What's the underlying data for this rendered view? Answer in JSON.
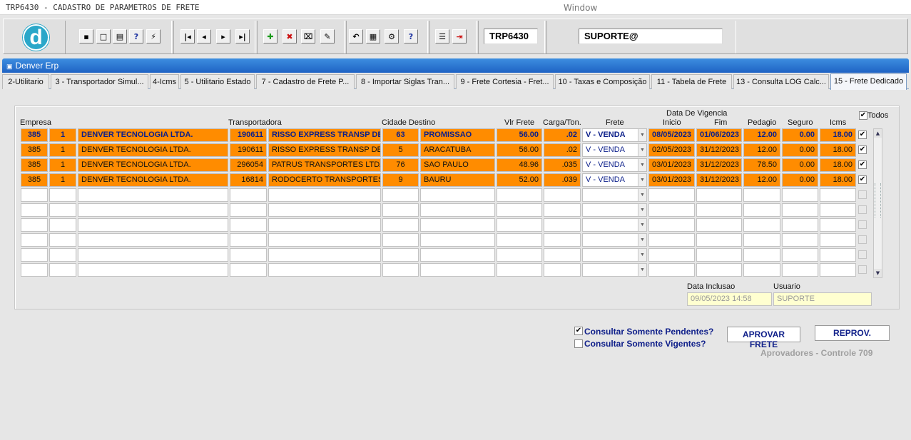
{
  "window": {
    "app_title": "TRP6430 - CADASTRO DE PARAMETROS DE FRETE",
    "window_title": "Window"
  },
  "toolbar": {
    "form_code": "TRP6430",
    "user": "SUPORTE@",
    "buttons": [
      {
        "name": "save-icon",
        "glyph": "▪"
      },
      {
        "name": "window-icon",
        "glyph": "□"
      },
      {
        "name": "print-icon",
        "glyph": "▤"
      },
      {
        "name": "query-icon",
        "glyph": "?"
      },
      {
        "name": "execute-query-icon",
        "glyph": "⚡"
      },
      {
        "name": "first-record-icon",
        "glyph": "|◂"
      },
      {
        "name": "previous-record-icon",
        "glyph": "◂"
      },
      {
        "name": "next-record-icon",
        "glyph": "▸"
      },
      {
        "name": "last-record-icon",
        "glyph": "▸|"
      },
      {
        "name": "insert-record-icon",
        "glyph": "✚"
      },
      {
        "name": "delete-record-icon",
        "glyph": "✖"
      },
      {
        "name": "clear-record-icon",
        "glyph": "⌧"
      },
      {
        "name": "edit-icon",
        "glyph": "✎"
      },
      {
        "name": "undo-icon",
        "glyph": "↶"
      },
      {
        "name": "clipboard-icon",
        "glyph": "▦"
      },
      {
        "name": "tools-icon",
        "glyph": "⚙"
      },
      {
        "name": "help-icon",
        "glyph": "?"
      },
      {
        "name": "menu-icon",
        "glyph": "☰"
      },
      {
        "name": "exit-icon",
        "glyph": "⇥"
      }
    ]
  },
  "app": {
    "name": "Denver Erp",
    "logo_letter": "d"
  },
  "tabs": [
    "2-Utilitario",
    "3 - Transportador Simul...",
    "4-Icms",
    "5 - Utilitario Estado",
    "7 - Cadastro de Frete P...",
    "8 - Importar Siglas Tran...",
    "9 - Frete Cortesia - Fret...",
    "10 - Taxas e Composição",
    "11 - Tabela de Frete",
    "13 - Consulta LOG Calc...",
    "15 - Frete Dedicado"
  ],
  "active_tab": "15 - Frete Dedicado",
  "grid": {
    "headers": {
      "empresa": "Empresa",
      "transportadora": "Transportadora",
      "cidade_destino": "Cidade Destino",
      "vlr_frete": "Vlr Frete",
      "carga_ton": "Carga/Ton.",
      "frete": "Frete",
      "data_vigencia": "Data De Vigencia",
      "inicio": "Inicio",
      "fim": "Fim",
      "pedagio": "Pedagio",
      "seguro": "Seguro",
      "icms": "Icms",
      "todos": "Todos"
    },
    "todos_checked": true,
    "rows": [
      {
        "empresa": "385",
        "filial": "1",
        "razao": "DENVER TECNOLOGIA LTDA.",
        "transp_cod": "190611",
        "transp_nome": "RISSO EXPRESS TRANSP DE C",
        "cidade_cod": "63",
        "cidade_nome": "PROMISSAO",
        "vlr_frete": "56.00",
        "carga": ".02",
        "frete": "V - VENDA",
        "inicio": "08/05/2023",
        "fim": "01/06/2023",
        "pedagio": "12.00",
        "seguro": "0.00",
        "icms": "18.00",
        "checked": true,
        "selected": true
      },
      {
        "empresa": "385",
        "filial": "1",
        "razao": "DENVER TECNOLOGIA LTDA.",
        "transp_cod": "190611",
        "transp_nome": "RISSO EXPRESS TRANSP DE CA",
        "cidade_cod": "5",
        "cidade_nome": "ARACATUBA",
        "vlr_frete": "56.00",
        "carga": ".02",
        "frete": "V - VENDA",
        "inicio": "02/05/2023",
        "fim": "31/12/2023",
        "pedagio": "12.00",
        "seguro": "0.00",
        "icms": "18.00",
        "checked": true,
        "selected": false
      },
      {
        "empresa": "385",
        "filial": "1",
        "razao": "DENVER TECNOLOGIA LTDA.",
        "transp_cod": "296054",
        "transp_nome": "PATRUS TRANSPORTES LTDA",
        "cidade_cod": "76",
        "cidade_nome": "SAO PAULO",
        "vlr_frete": "48.96",
        "carga": ".035",
        "frete": "V - VENDA",
        "inicio": "03/01/2023",
        "fim": "31/12/2023",
        "pedagio": "78.50",
        "seguro": "0.00",
        "icms": "18.00",
        "checked": true,
        "selected": false
      },
      {
        "empresa": "385",
        "filial": "1",
        "razao": "DENVER TECNOLOGIA LTDA.",
        "transp_cod": "16814",
        "transp_nome": "RODOCERTO TRANSPORTES LT",
        "cidade_cod": "9",
        "cidade_nome": "BAURU",
        "vlr_frete": "52.00",
        "carga": ".039",
        "frete": "V - VENDA",
        "inicio": "03/01/2023",
        "fim": "31/12/2023",
        "pedagio": "12.00",
        "seguro": "0.00",
        "icms": "18.00",
        "checked": true,
        "selected": false
      }
    ],
    "empty_rows": 6
  },
  "audit": {
    "data_inclusao_label": "Data Inclusao",
    "data_inclusao": "09/05/2023 14:58",
    "usuario_label": "Usuario",
    "usuario": "SUPORTE"
  },
  "filters": {
    "pendentes_label": "Consultar Somente Pendentes?",
    "pendentes_checked": true,
    "vigentes_label": "Consultar Somente Vigentes?",
    "vigentes_checked": false
  },
  "actions": {
    "aprovar_label": "APROVAR FRETE",
    "reprov_label": "REPROV.",
    "aprovadores_note": "Aprovadores - Controle 709"
  },
  "colors": {
    "row_highlight": "#ff8c00",
    "selected_text": "#0b1f8a",
    "erp_bar": "#1f63c4"
  }
}
